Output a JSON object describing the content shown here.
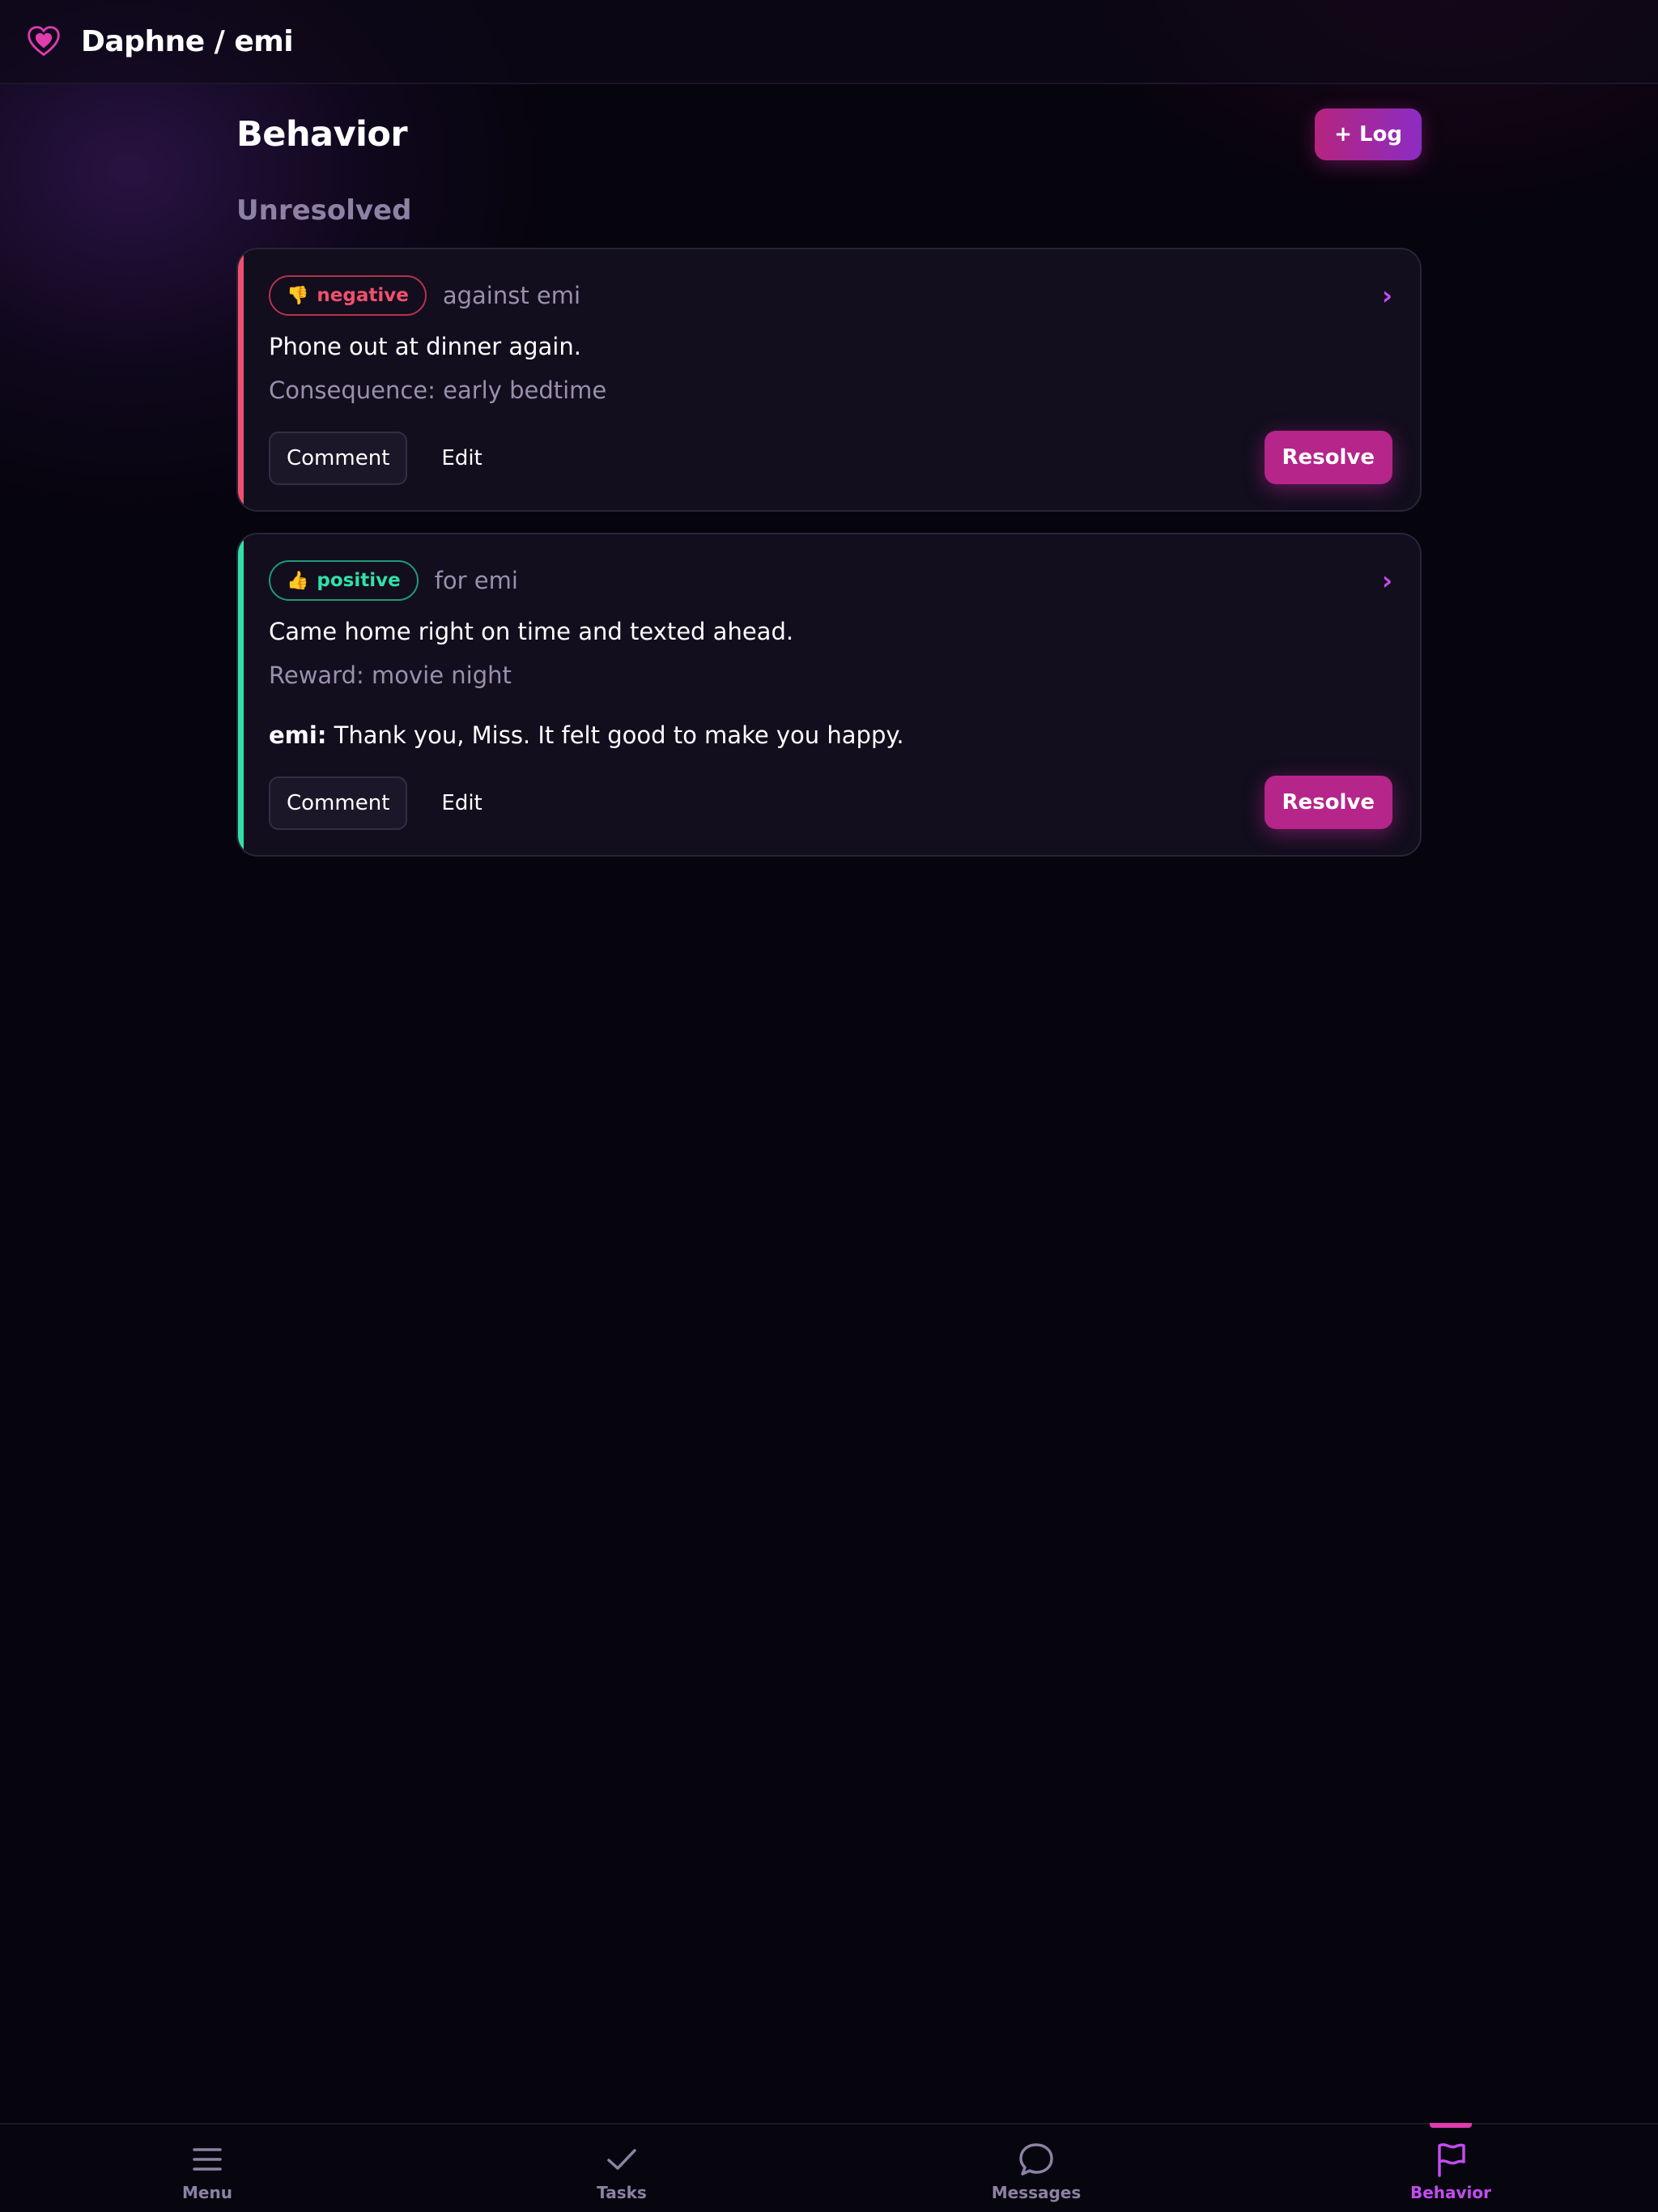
{
  "app": {
    "title": "Daphne / emi"
  },
  "page": {
    "title": "Behavior",
    "log_button": "+ Log",
    "section": "Unresolved"
  },
  "entries": [
    {
      "type": "negative",
      "emoji": "👎",
      "target": "against emi",
      "description": "Phone out at dinner again.",
      "outcome": "Consequence: early bedtime",
      "actions": {
        "comment": "Comment",
        "edit": "Edit",
        "resolve": "Resolve"
      }
    },
    {
      "type": "positive",
      "emoji": "👍",
      "target": "for emi",
      "description": "Came home right on time and texted ahead.",
      "outcome": "Reward: movie night",
      "reply": {
        "author": "emi:",
        "text": " Thank you, Miss. It felt good to make you happy."
      },
      "actions": {
        "comment": "Comment",
        "edit": "Edit",
        "resolve": "Resolve"
      }
    }
  ],
  "chevron": "›",
  "nav": [
    {
      "label": "Menu",
      "icon": "menu-icon"
    },
    {
      "label": "Tasks",
      "icon": "check-icon"
    },
    {
      "label": "Messages",
      "icon": "chat-bubble-icon"
    },
    {
      "label": "Behavior",
      "icon": "flag-icon",
      "active": true
    }
  ],
  "colors": {
    "accent": "#c44cf0",
    "negative": "#f0506e",
    "positive": "#31e0a8",
    "primary_button": "#b5258a"
  }
}
